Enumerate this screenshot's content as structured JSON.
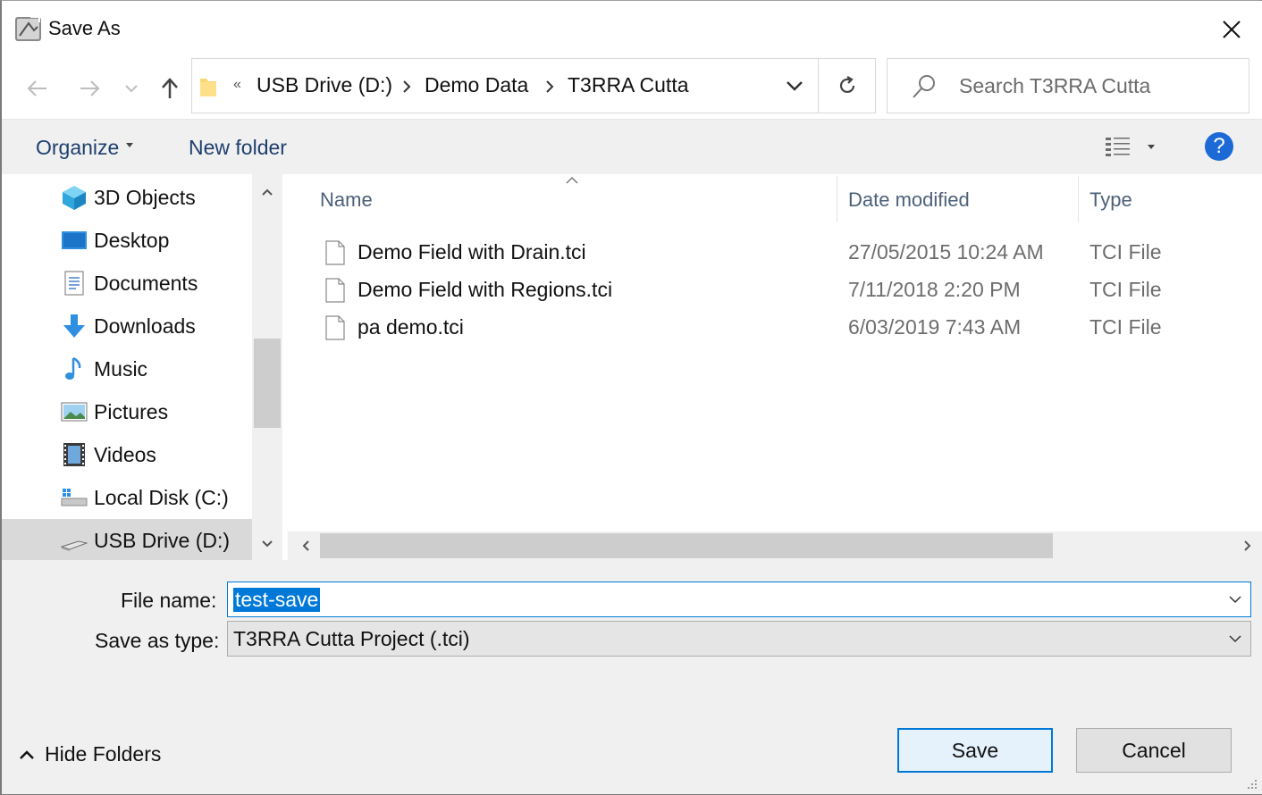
{
  "window": {
    "title": "Save As"
  },
  "address": {
    "overflow": "«",
    "crumbs": [
      "USB Drive (D:)",
      "Demo Data",
      "T3RRA Cutta"
    ]
  },
  "search": {
    "placeholder": "Search T3RRA Cutta"
  },
  "toolbar": {
    "organize": "Organize",
    "new_folder": "New folder"
  },
  "nav": {
    "items": [
      {
        "label": "3D Objects",
        "icon": "3d-objects-icon"
      },
      {
        "label": "Desktop",
        "icon": "desktop-icon"
      },
      {
        "label": "Documents",
        "icon": "documents-icon"
      },
      {
        "label": "Downloads",
        "icon": "downloads-icon"
      },
      {
        "label": "Music",
        "icon": "music-icon"
      },
      {
        "label": "Pictures",
        "icon": "pictures-icon"
      },
      {
        "label": "Videos",
        "icon": "videos-icon"
      },
      {
        "label": "Local Disk (C:)",
        "icon": "local-disk-icon"
      },
      {
        "label": "USB Drive (D:)",
        "icon": "usb-drive-icon",
        "selected": true
      }
    ]
  },
  "columns": {
    "name": "Name",
    "date": "Date modified",
    "type": "Type"
  },
  "files": [
    {
      "name": "Demo Field with Drain.tci",
      "date": "27/05/2015 10:24 AM",
      "type": "TCI File"
    },
    {
      "name": "Demo Field with Regions.tci",
      "date": "7/11/2018 2:20 PM",
      "type": "TCI File"
    },
    {
      "name": "pa demo.tci",
      "date": "6/03/2019 7:43 AM",
      "type": "TCI File"
    }
  ],
  "form": {
    "file_name_label": "File name:",
    "file_name_value": "test-save",
    "save_type_label": "Save as type:",
    "save_type_value": "T3RRA Cutta Project (.tci)"
  },
  "footer": {
    "hide_folders": "Hide Folders",
    "save": "Save",
    "cancel": "Cancel"
  },
  "colors": {
    "accent": "#0078d7",
    "help": "#1d6ad6",
    "selected_nav": "#d9d9d9"
  }
}
